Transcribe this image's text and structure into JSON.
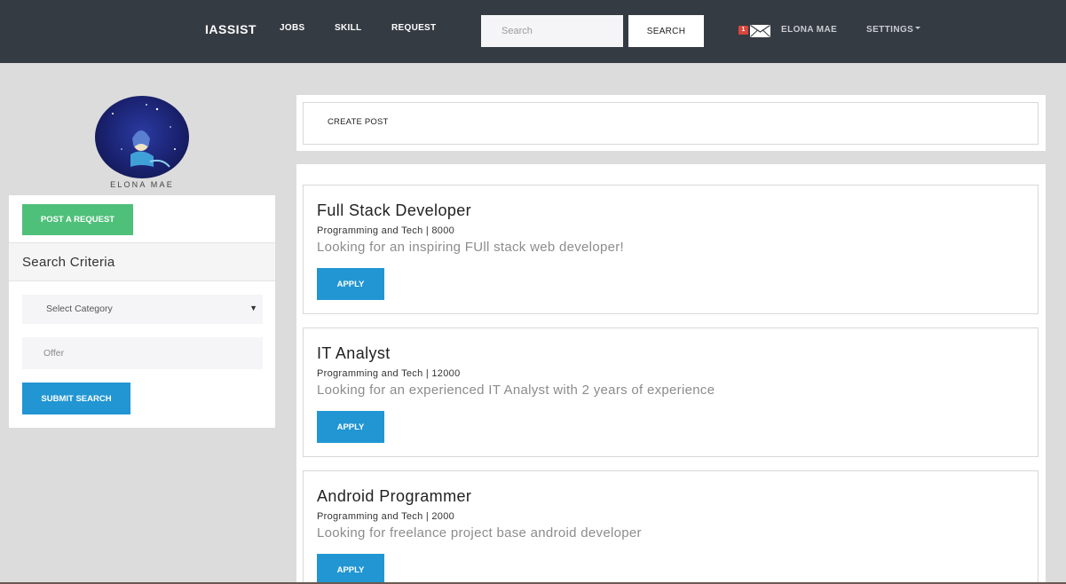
{
  "navbar": {
    "brand": "IASSIST",
    "links": [
      "JOBS",
      "SKILL",
      "REQUEST"
    ],
    "search_placeholder": "Search",
    "search_button": "SEARCH",
    "mail_badge": "1",
    "user_name": "ELONA MAE",
    "settings_label": "SETTINGS"
  },
  "profile": {
    "name": "ELONA MAE"
  },
  "sidebar": {
    "post_request_label": "POST A REQUEST",
    "criteria_title": "Search Criteria",
    "category_selected": "Select Category",
    "offer_placeholder": "Offer",
    "submit_label": "SUBMIT SEARCH"
  },
  "create_post": {
    "label": "CREATE POST"
  },
  "jobs": [
    {
      "title": "Full Stack Developer",
      "meta": "Programming and Tech | 8000",
      "description": "Looking for an inspiring FUll stack web developer!",
      "apply_label": "APPLY"
    },
    {
      "title": "IT Analyst",
      "meta": "Programming and Tech | 12000",
      "description": "Looking for an experienced IT Analyst with 2 years of experience",
      "apply_label": "APPLY"
    },
    {
      "title": "Android Programmer",
      "meta": "Programming and Tech | 2000",
      "description": "Looking for freelance project base android developer",
      "apply_label": "APPLY"
    }
  ],
  "colors": {
    "navbar_bg": "#353b43",
    "page_bg": "#dcdcdc",
    "primary_button": "#2196d3",
    "success_button": "#4fc07a",
    "badge": "#d9463c"
  },
  "icons": {
    "mail": "envelope-icon",
    "settings_caret": "caret-down-icon",
    "select_arrow": "triangle-down-icon"
  }
}
